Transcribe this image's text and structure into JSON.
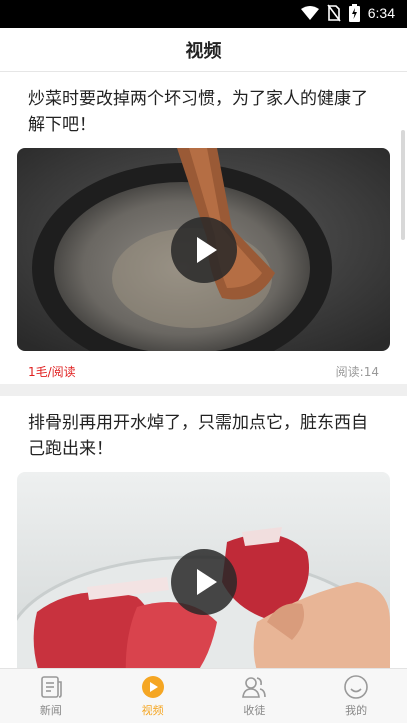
{
  "status_bar": {
    "time": "6:34",
    "icons": [
      "wifi-icon",
      "no-sim-icon",
      "battery-charging-icon"
    ]
  },
  "header": {
    "title": "视频"
  },
  "feed": [
    {
      "title": "炒菜时要改掉两个坏习惯，为了家人的健康了解下吧！",
      "reward": "1毛/阅读",
      "reads": "阅读:14",
      "thumbnail": "pan-stir-fry-video"
    },
    {
      "title": "排骨别再用开水焯了，只需加点它，脏东西自己跑出来！",
      "thumbnail": "pork-ribs-bowl-video"
    }
  ],
  "tabbar": {
    "items": [
      {
        "label": "新闻",
        "icon": "news-icon",
        "active": false
      },
      {
        "label": "视频",
        "icon": "video-play-icon",
        "active": true
      },
      {
        "label": "收徒",
        "icon": "apprentice-icon",
        "active": false
      },
      {
        "label": "我的",
        "icon": "profile-smile-icon",
        "active": false
      }
    ],
    "active_color": "#f5a623"
  },
  "colors": {
    "accent": "#f5a623",
    "reward": "#e02020"
  }
}
